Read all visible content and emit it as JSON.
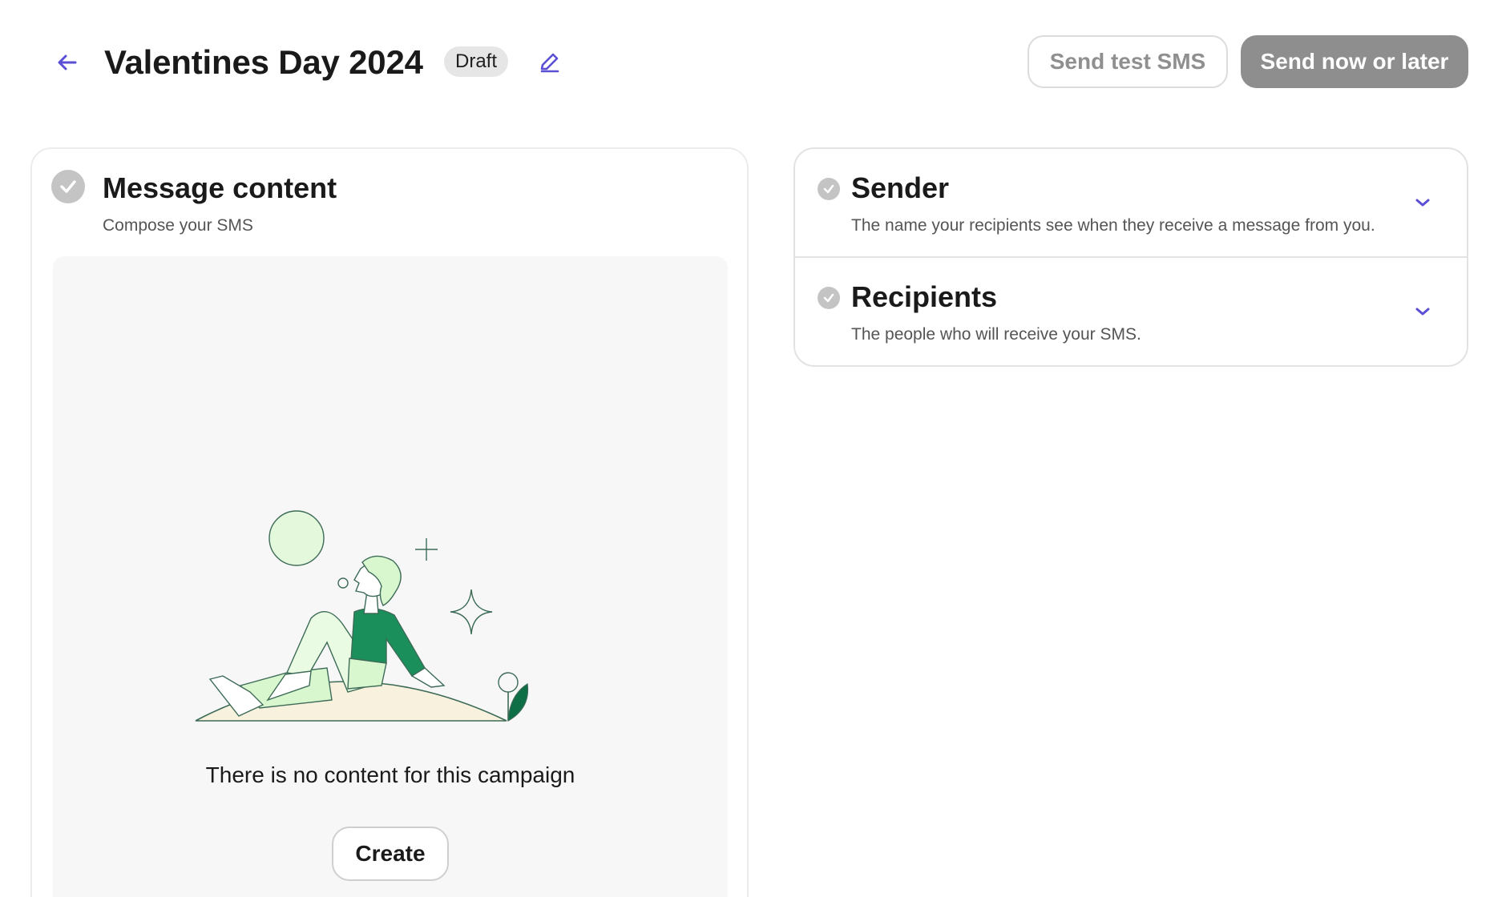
{
  "header": {
    "title": "Valentines Day 2024",
    "status_badge": "Draft",
    "test_button": "Send test SMS",
    "send_button": "Send now or later"
  },
  "message_content": {
    "title": "Message content",
    "subtitle": "Compose your SMS",
    "empty_text": "There is no content for this campaign",
    "create_button": "Create"
  },
  "sections": [
    {
      "title": "Sender",
      "subtitle": "The name your recipients see when they receive a message from you."
    },
    {
      "title": "Recipients",
      "subtitle": "The people who will receive your SMS."
    }
  ],
  "colors": {
    "accent": "#5b4fd6",
    "primary_disabled": "#8e8e8e",
    "illustration_green": "#1a8f5c",
    "illustration_light_green": "#e4f9dc",
    "ground": "#f7f1dd"
  },
  "icons": {
    "back": "arrow-left-icon",
    "edit": "pencil-icon",
    "complete": "check-circle-icon",
    "expand": "chevron-down-icon"
  }
}
